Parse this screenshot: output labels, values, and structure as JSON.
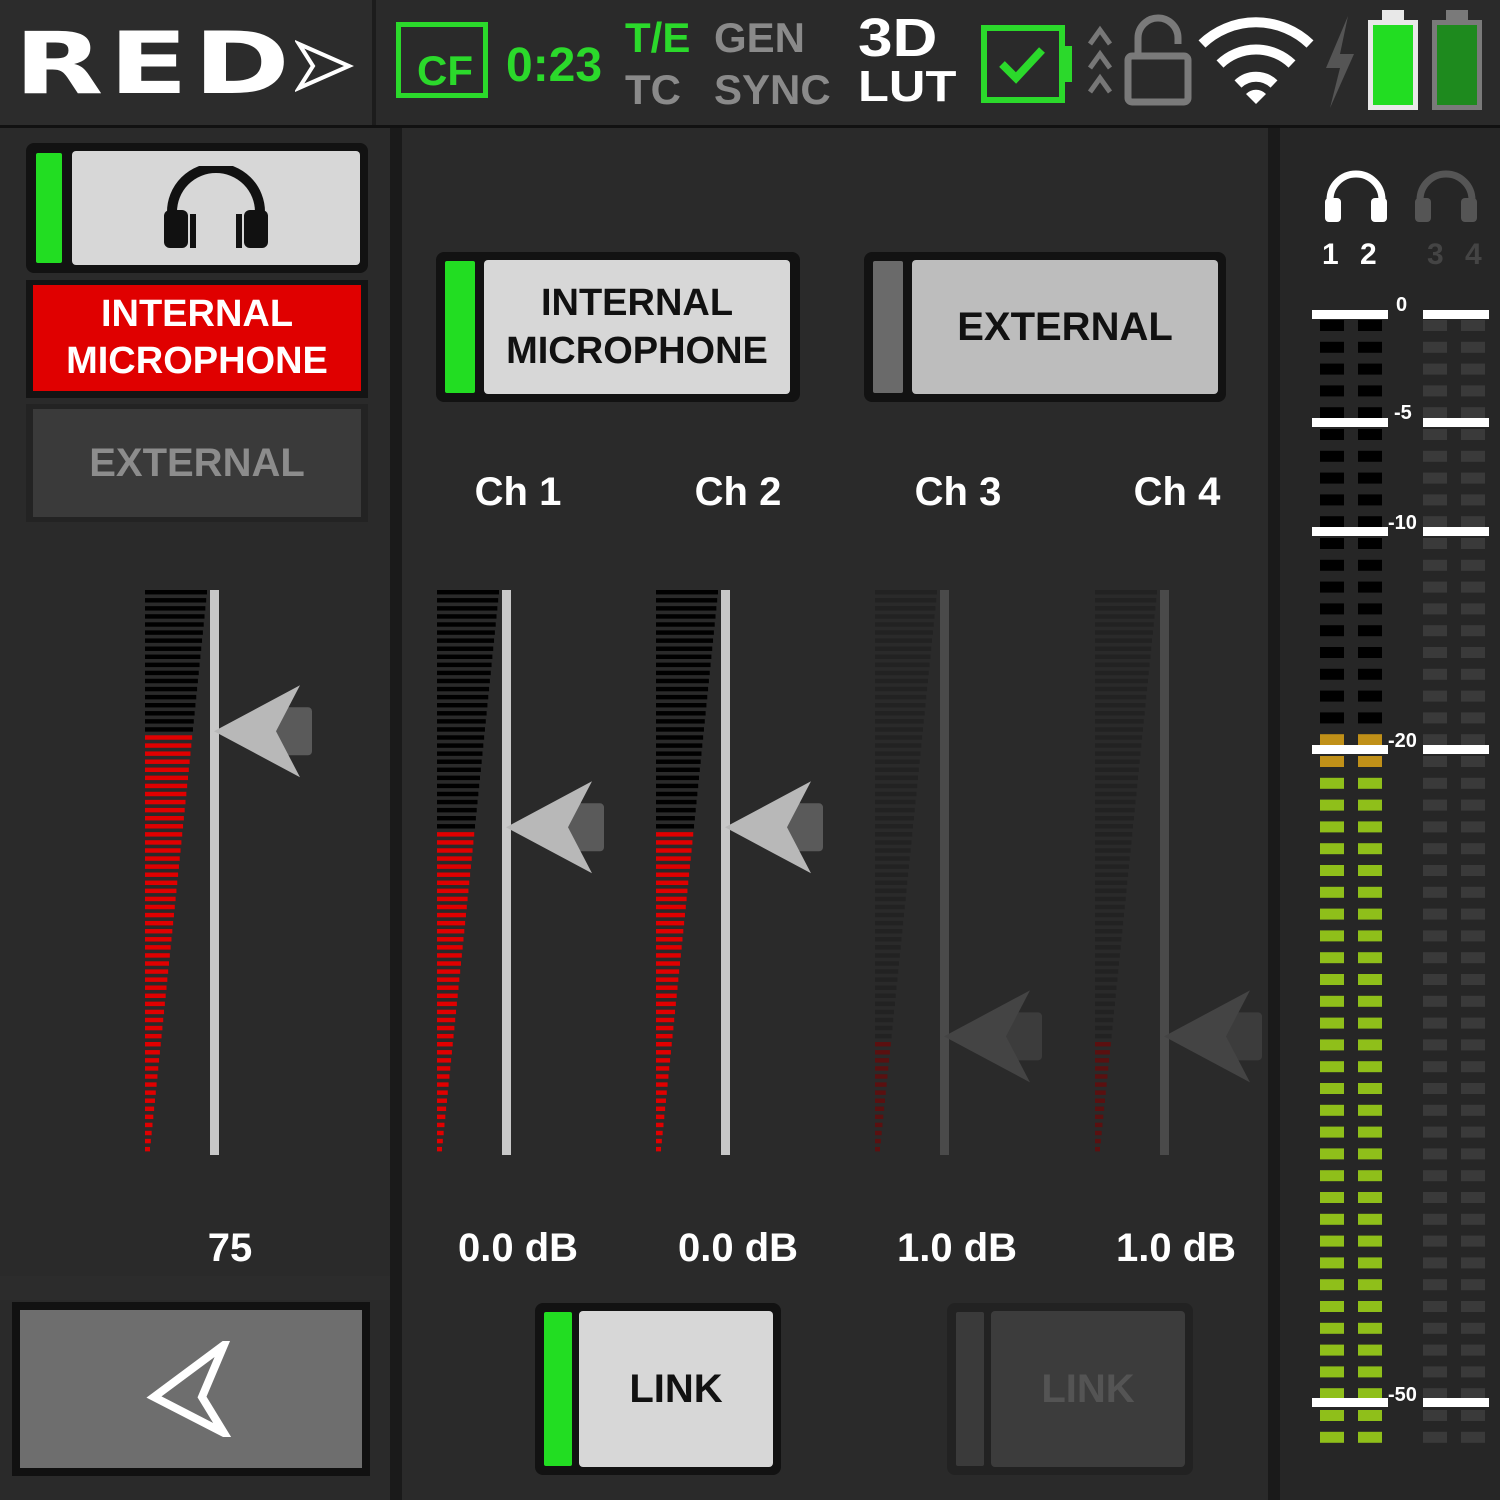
{
  "brand": {
    "logo_text": "RED"
  },
  "status_bar": {
    "media_label": "CF",
    "record_time": "0:23",
    "te_label": "T/E",
    "tc_label": "TC",
    "gen_label": "GEN",
    "sync_label": "SYNC",
    "lut_top": "3D",
    "lut_bottom": "LUT",
    "colors": {
      "active_green": "#2bd92b",
      "inactive_gray": "#8a8a8a"
    }
  },
  "left_panel": {
    "monitor_icon": "headphones-icon",
    "internal_mic_label": "INTERNAL MICROPHONE",
    "external_label": "EXTERNAL",
    "headphone_volume": "75",
    "headphone_level_fraction": 0.75
  },
  "center_panel": {
    "source_internal_label": "INTERNAL MICROPHONE",
    "source_external_label": "EXTERNAL",
    "channels": [
      {
        "label": "Ch 1",
        "gain": "0.0 dB",
        "enabled": true
      },
      {
        "label": "Ch 2",
        "gain": "0.0 dB",
        "enabled": true
      },
      {
        "label": "Ch 3",
        "gain": "1.0 dB",
        "enabled": false
      },
      {
        "label": "Ch 4",
        "gain": "1.0 dB",
        "enabled": false
      }
    ],
    "link_12_label": "LINK",
    "link_34_label": "LINK"
  },
  "meters": {
    "monitor_channels": [
      "1",
      "2",
      "3",
      "4"
    ],
    "scale": [
      "0",
      "-5",
      "-10",
      "-20",
      "-50"
    ],
    "colors": {
      "green": "#8fbf1a",
      "amber": "#c09018",
      "white": "#ffffff"
    }
  }
}
